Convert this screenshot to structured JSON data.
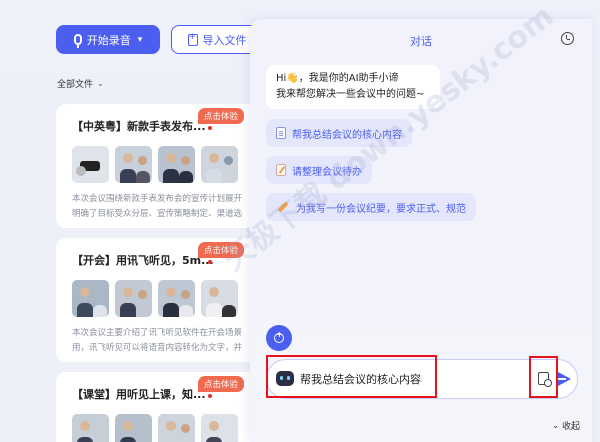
{
  "toolbar": {
    "record_label": "开始录音",
    "import_label": "导入文件"
  },
  "filter": {
    "label": "全部文件"
  },
  "cards": [
    {
      "title": "【中英粤】新款手表发布...",
      "badge": "点击体验",
      "desc_line1": "本次会议围绕新款手表发布会的宣传计划展开",
      "desc_line2": "明确了目标受众分层、宣传策略制定、渠道选"
    },
    {
      "title": "【开会】用讯飞听见，5m...",
      "badge": "点击体验",
      "desc_line1": "本次会议主要介绍了讯飞听见软件在开会场景",
      "desc_line2": "用，讯飞听见可以将语音内容转化为文字，并"
    },
    {
      "title": "【课堂】用听见上课，知...",
      "badge": "点击体验"
    }
  ],
  "chat": {
    "title": "对话",
    "greeting_line1": "Hi",
    "greeting_wave": "👋",
    "greeting_line1_rest": "，我是你的AI助手小谛",
    "greeting_line2": "我来帮您解决一些会议中的问题~",
    "suggestions": [
      {
        "label": "帮我总结会议的核心内容",
        "icon": "document-icon"
      },
      {
        "label": "请整理会议待办",
        "icon": "note-icon"
      },
      {
        "label": "为我写一份会议纪要，要求正式、规范",
        "icon": "pencil-icon"
      }
    ],
    "input_value": "帮我总结会议的核心内容",
    "collapse_label": "收起"
  },
  "watermark": {
    "text": "天极下载 down.yesky.com"
  },
  "colors": {
    "accent": "#4b5ef0",
    "badge": "#f06a50",
    "highlight": "#e3141e",
    "panel_bg": "#f2f2fc"
  }
}
